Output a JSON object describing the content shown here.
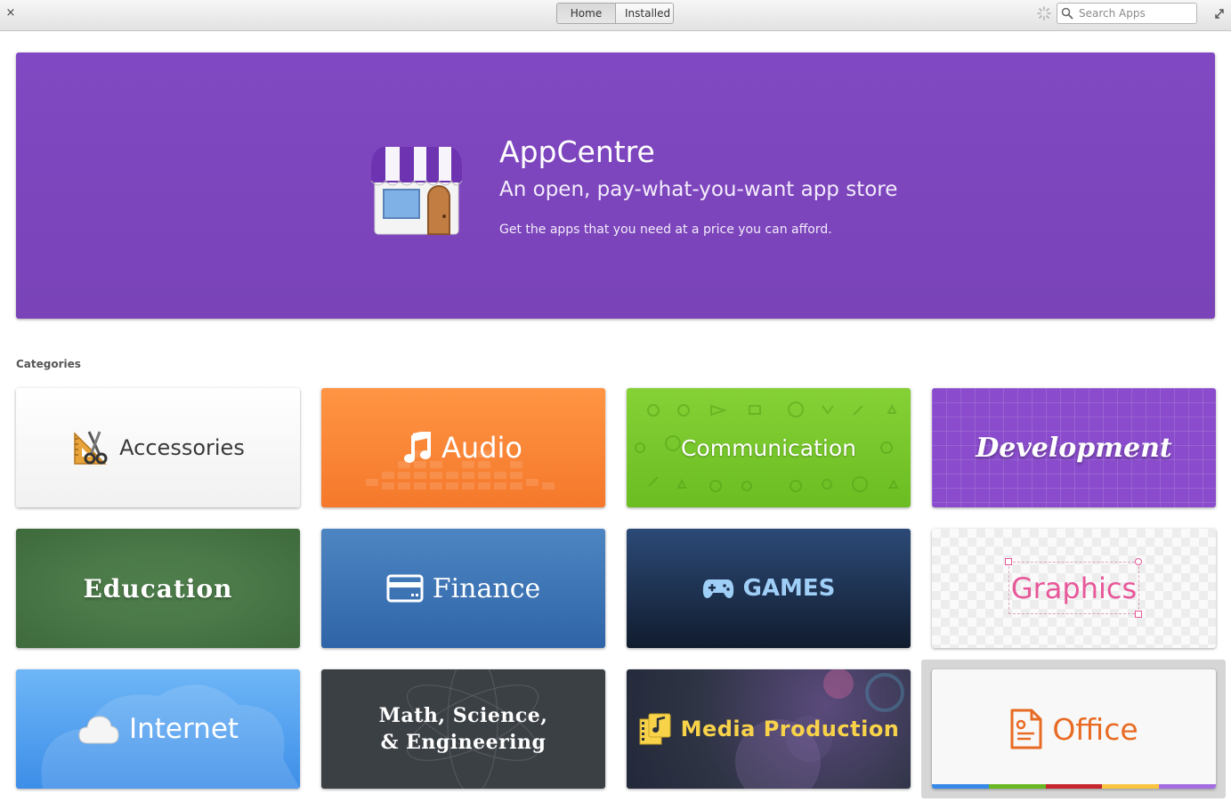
{
  "window": {
    "close_glyph": "×",
    "fullscreen_icon": "expand-arrows-icon"
  },
  "header": {
    "tabs": [
      {
        "label": "Home",
        "active": true
      },
      {
        "label": "Installed",
        "active": false
      }
    ],
    "spinner_icon": "loading-spinner-icon",
    "search": {
      "placeholder": "Search Apps",
      "value": ""
    }
  },
  "banner": {
    "title": "AppCentre",
    "subtitle": "An open, pay-what-you-want app store",
    "description": "Get the apps that you need at a price you can afford.",
    "background_color": "#7d46bd",
    "icon": "storefront-icon"
  },
  "categories": {
    "heading": "Categories",
    "items": [
      {
        "label": "Accessories",
        "icon": "scissors-ruler-icon",
        "color": "#f5f5f5"
      },
      {
        "label": "Audio",
        "icon": "music-note-icon",
        "color": "#f98636"
      },
      {
        "label": "Communication",
        "icon": "",
        "color": "#79c72b"
      },
      {
        "label": "Development",
        "icon": "",
        "color": "#8a4ccc"
      },
      {
        "label": "Education",
        "icon": "",
        "color": "#4a7848"
      },
      {
        "label": "Finance",
        "icon": "credit-card-icon",
        "color": "#3b72b2"
      },
      {
        "label": "GAMES",
        "icon": "gamepad-icon",
        "color": "#1c2d49"
      },
      {
        "label": "Graphics",
        "icon": "",
        "color": "#e8579a"
      },
      {
        "label": "Internet",
        "icon": "cloud-icon",
        "color": "#4f9ef0"
      },
      {
        "label_line1": "Math, Science,",
        "label_line2": "& Engineering",
        "icon": "",
        "color": "#3b4045"
      },
      {
        "label": "Media Production",
        "icon": "film-music-icon",
        "color": "#f8d34a"
      },
      {
        "label": "Office",
        "icon": "document-icon",
        "color": "#e86b24",
        "selected": true,
        "stripe_colors": [
          "#3689e6",
          "#68b723",
          "#c6262e",
          "#f9c440",
          "#a56de2"
        ]
      }
    ]
  }
}
